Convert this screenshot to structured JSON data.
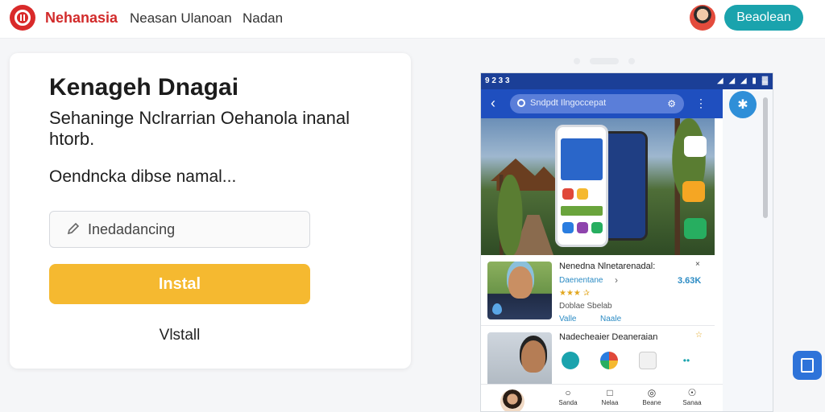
{
  "header": {
    "brand": "Nehanasia",
    "nav": [
      "Neasan Ulanoan",
      "Nadan"
    ],
    "button_label": "Beaolean"
  },
  "card": {
    "title": "Kenageh Dnagai",
    "description": "Sehaninge Nclrarrian Oehanola inanal htorb.",
    "subtitle": "Oendncka dibse namal...",
    "search_placeholder": "Inedadancing",
    "install_label": "Instal",
    "secondary_label": "Vlstall"
  },
  "phone": {
    "status_time": "9 2 3 3",
    "status_icons": "◢ ◢ ◢ ▮ ▓",
    "search_text": "Sndpdt Ilngoccepat",
    "items": [
      {
        "title": "Nenedna Nlnetarenadal:",
        "meta": "Daenentane",
        "rating": "★★★ ✰",
        "sub": "Doblae Sbelab",
        "tag1": "Valle",
        "tag2": "Naale",
        "price": "3.63K",
        "close": "×"
      },
      {
        "title": "Nadecheaier Deaneraian",
        "close": "☆"
      }
    ],
    "nav_tabs": [
      {
        "icon": "○",
        "label": "Sanda"
      },
      {
        "icon": "□",
        "label": "Nelaa"
      },
      {
        "icon": "◎",
        "label": "Beane"
      },
      {
        "icon": "☉",
        "label": "Sanaa"
      }
    ]
  },
  "colors": {
    "brand_red": "#d22b2b",
    "accent_teal": "#1aa3ad",
    "install_yellow": "#f5b930",
    "phone_blue": "#1f4fbf"
  }
}
